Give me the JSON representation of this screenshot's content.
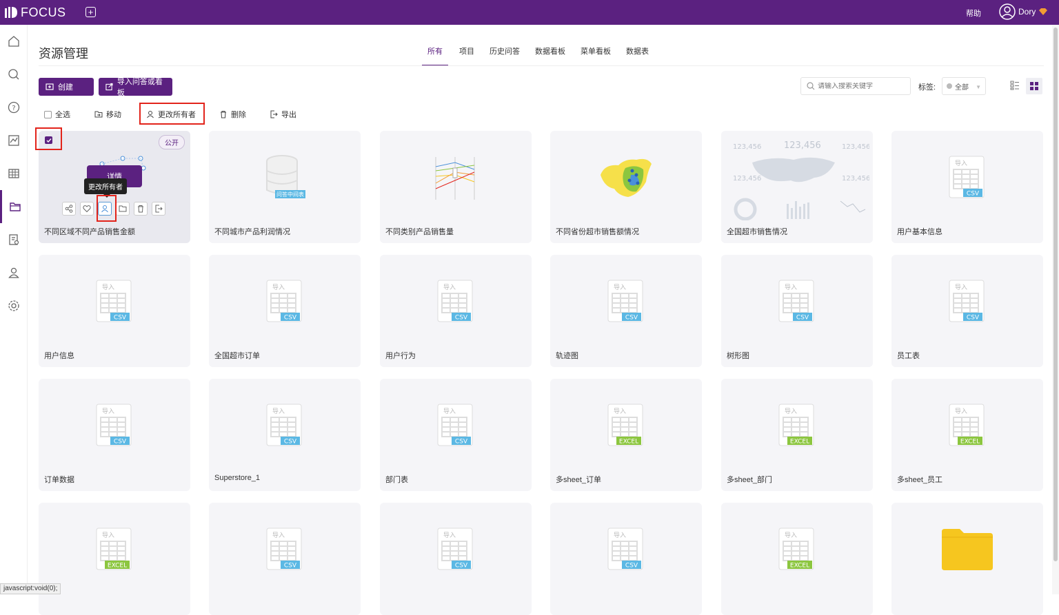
{
  "app": {
    "logo": "FOCUS",
    "help": "帮助",
    "user_name": "Dory"
  },
  "page": {
    "title": "资源管理"
  },
  "tabs": [
    "所有",
    "项目",
    "历史问答",
    "数据看板",
    "菜单看板",
    "数据表"
  ],
  "actions": {
    "create": "创建",
    "import": "导入问答或看板"
  },
  "search": {
    "placeholder": "请输入搜索关键字"
  },
  "tag": {
    "label": "标签:",
    "value": "全部"
  },
  "toolbar": {
    "select_all": "全选",
    "move": "移动",
    "change_owner": "更改所有者",
    "delete": "删除",
    "export": "导出"
  },
  "selected_card": {
    "badge": "公开",
    "detail": "详情",
    "tooltip": "更改所有者"
  },
  "thumb_text": {
    "import": "导入",
    "mid_table": "问答中间表",
    "kpi": "123,456"
  },
  "cards": [
    {
      "label": "不同区域不同产品销售金额",
      "kind": "selected"
    },
    {
      "label": "不同城市产品利润情况",
      "kind": "db"
    },
    {
      "label": "不同类别产品销售量",
      "kind": "parallel"
    },
    {
      "label": "不同省份超市销售额情况",
      "kind": "map"
    },
    {
      "label": "全国超市销售情况",
      "kind": "dashboard"
    },
    {
      "label": "用户基本信息",
      "kind": "file",
      "tag": "CSV"
    },
    {
      "label": "用户信息",
      "kind": "file",
      "tag": "CSV"
    },
    {
      "label": "全国超市订单",
      "kind": "file",
      "tag": "CSV"
    },
    {
      "label": "用户行为",
      "kind": "file",
      "tag": "CSV"
    },
    {
      "label": "轨迹图",
      "kind": "file",
      "tag": "CSV"
    },
    {
      "label": "树形图",
      "kind": "file",
      "tag": "CSV"
    },
    {
      "label": "员工表",
      "kind": "file",
      "tag": "CSV"
    },
    {
      "label": "订单数据",
      "kind": "file",
      "tag": "CSV"
    },
    {
      "label": "Superstore_1",
      "kind": "file",
      "tag": "CSV"
    },
    {
      "label": "部门表",
      "kind": "file",
      "tag": "CSV"
    },
    {
      "label": "多sheet_订单",
      "kind": "file",
      "tag": "EXCEL"
    },
    {
      "label": "多sheet_部门",
      "kind": "file",
      "tag": "EXCEL"
    },
    {
      "label": "多sheet_员工",
      "kind": "file",
      "tag": "EXCEL"
    },
    {
      "label": "",
      "kind": "file",
      "tag": "EXCEL"
    },
    {
      "label": "",
      "kind": "file",
      "tag": "CSV"
    },
    {
      "label": "",
      "kind": "file",
      "tag": "CSV"
    },
    {
      "label": "",
      "kind": "file",
      "tag": "CSV"
    },
    {
      "label": "",
      "kind": "file",
      "tag": "EXCEL"
    },
    {
      "label": "",
      "kind": "folder"
    }
  ],
  "colors": {
    "brand": "#5b2180",
    "csv": "#5bb8e4",
    "excel": "#8cc63f",
    "highlight": "#e2231a",
    "folder": "#f6c61f"
  },
  "status_bar": "javascript:void(0);"
}
